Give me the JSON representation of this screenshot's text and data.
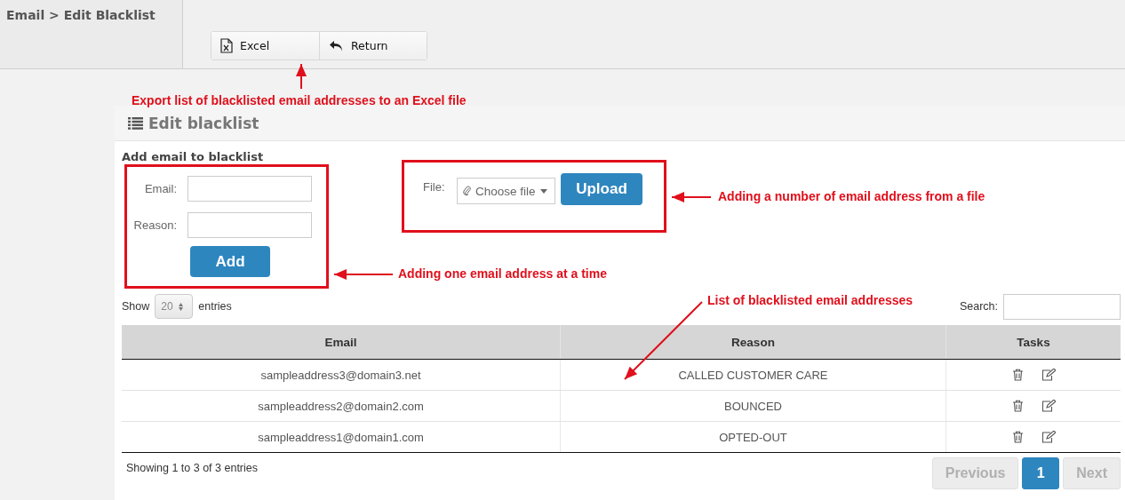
{
  "breadcrumb": "Email > Edit Blacklist",
  "toolbar": [
    {
      "label": "Excel",
      "kind": "excel"
    },
    {
      "label": "Return",
      "kind": "return"
    }
  ],
  "panel": {
    "title": "Edit blacklist"
  },
  "add_form": {
    "heading": "Add email to blacklist",
    "fields": [
      {
        "label": "Email:"
      },
      {
        "label": "Reason:"
      }
    ],
    "button": "Add"
  },
  "upload_form": {
    "label": "File:",
    "chooser": "Choose file",
    "button": "Upload"
  },
  "table_controls": {
    "show_label": "Show",
    "page_size": "20",
    "entries_label": "entries",
    "search_label": "Search:"
  },
  "table": {
    "columns": [
      "Email",
      "Reason",
      "Tasks"
    ],
    "rows": [
      {
        "email": "sampleaddress3@domain3.net",
        "reason": "CALLED CUSTOMER CARE"
      },
      {
        "email": "sampleaddress2@domain2.com",
        "reason": "BOUNCED"
      },
      {
        "email": "sampleaddress1@domain1.com",
        "reason": "OPTED-OUT"
      }
    ]
  },
  "footer": {
    "info": "Showing 1 to 3 of 3 entries",
    "pagination": [
      {
        "label": "Previous",
        "selected": false,
        "disabled": true
      },
      {
        "label": "1",
        "selected": true,
        "disabled": false
      },
      {
        "label": "Next",
        "selected": false,
        "disabled": true
      }
    ]
  },
  "annotations": [
    {
      "text": "Export list of blacklisted email addresses to an Excel file",
      "framed": false
    },
    {
      "text": "Adding a number of email address from a file",
      "framed": true
    },
    {
      "text": "Adding one email address at a time",
      "framed": true
    },
    {
      "text": "List of blacklisted email addresses",
      "framed": false
    }
  ]
}
